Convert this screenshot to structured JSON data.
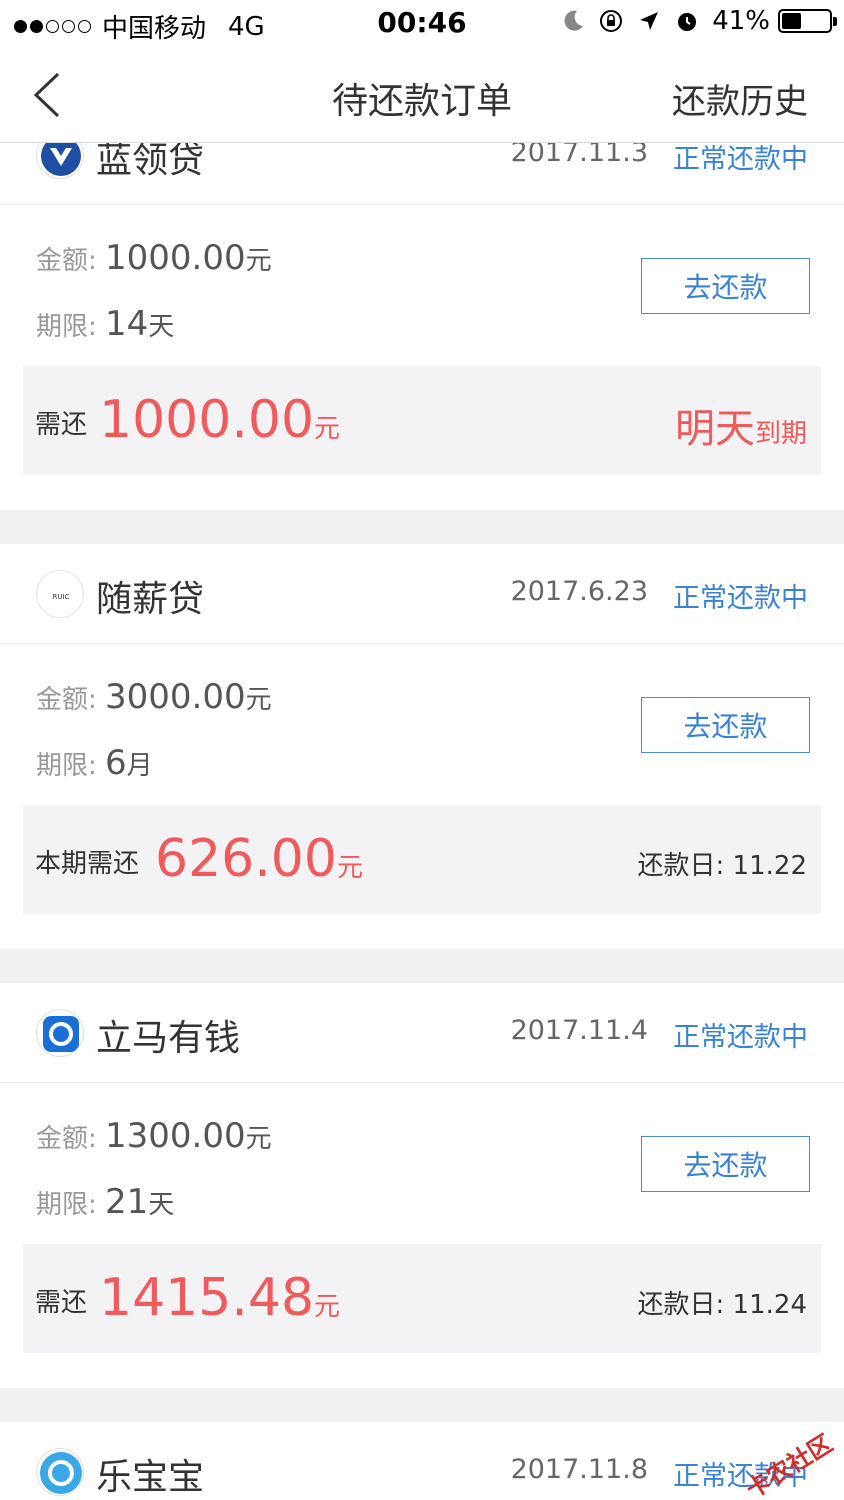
{
  "status_bar": {
    "carrier": "中国移动",
    "network": "4G",
    "time": "00:46",
    "battery_percent": 41,
    "battery_text": "41%"
  },
  "nav": {
    "title": "待还款订单",
    "right_link": "还款历史",
    "back_icon": "chevron-left-icon"
  },
  "colors": {
    "accent_blue": "#3a82d8",
    "amount_red": "#f05a5a",
    "divider_gray": "#f0f0f2"
  },
  "labels": {
    "amount": "金额:",
    "term": "期限:",
    "pay_button": "去还款",
    "currency": "元"
  },
  "orders": [
    {
      "name": "蓝领贷",
      "date": "2017.11.3",
      "status": "正常还款中",
      "amount": "1000.00",
      "term_value": "14",
      "term_unit": "天",
      "due_label": "需还",
      "due_amount": "1000.00",
      "due_right_big": "明天",
      "due_right_small": "到期"
    },
    {
      "name": "随薪贷",
      "date": "2017.6.23",
      "status": "正常还款中",
      "amount": "3000.00",
      "term_value": "6",
      "term_unit": "月",
      "due_label": "本期需还",
      "due_amount": "626.00",
      "due_right_text": "还款日: 11.22"
    },
    {
      "name": "立马有钱",
      "date": "2017.11.4",
      "status": "正常还款中",
      "amount": "1300.00",
      "term_value": "21",
      "term_unit": "天",
      "due_label": "需还",
      "due_amount": "1415.48",
      "due_right_text": "还款日: 11.24"
    },
    {
      "name": "乐宝宝",
      "date": "2017.11.8",
      "status": "正常还款中"
    }
  ],
  "watermark": "卡农社区"
}
